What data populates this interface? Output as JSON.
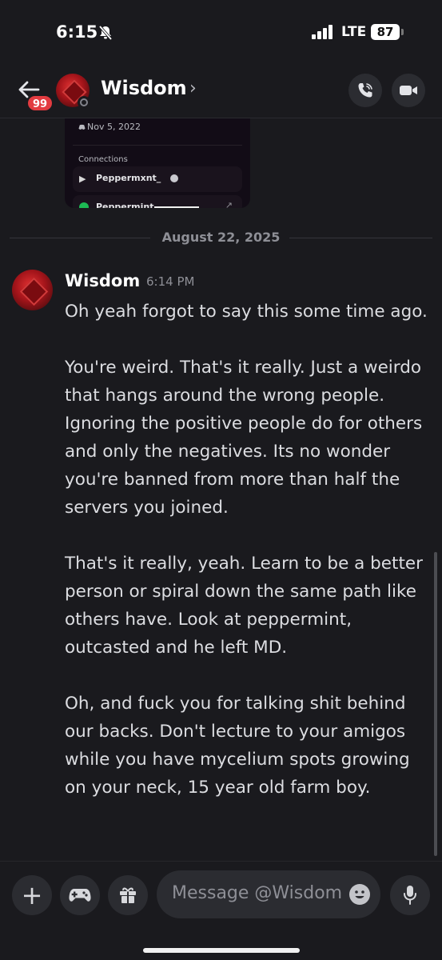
{
  "status_bar": {
    "time": "6:15",
    "network": "LTE",
    "battery": "87"
  },
  "header": {
    "unread_badge": "99",
    "title": "Wisdom",
    "chevron": "›"
  },
  "embed": {
    "date": "Nov 5, 2022",
    "connections_label": "Connections",
    "connections": [
      {
        "service": "playstation-icon",
        "name": "Peppermxnt_"
      },
      {
        "service": "spotify-icon",
        "name": "Peppermint"
      }
    ]
  },
  "divider": {
    "date": "August 22, 2025"
  },
  "message": {
    "author": "Wisdom",
    "time": "6:14 PM",
    "paragraphs": [
      "Oh yeah forgot to say this some time ago.",
      "You're weird. That's it really. Just a weirdo that hangs around the wrong people. Ignoring the positive people do for others and only the negatives. Its no wonder you're banned from more than half the servers you joined.",
      "That's it really, yeah. Learn to be a better person or spiral down the same path like others have. Look at peppermint, outcasted and he left MD.",
      "Oh, and fuck you for talking shit behind our backs. Don't lecture to your amigos while you have mycelium spots growing on your neck, 15 year old farm boy."
    ]
  },
  "composer": {
    "placeholder": "Message @Wisdom",
    "plus": "+"
  },
  "colors": {
    "background": "#1a1a1e",
    "badge": "#e23b40",
    "spotify": "#1db954"
  }
}
